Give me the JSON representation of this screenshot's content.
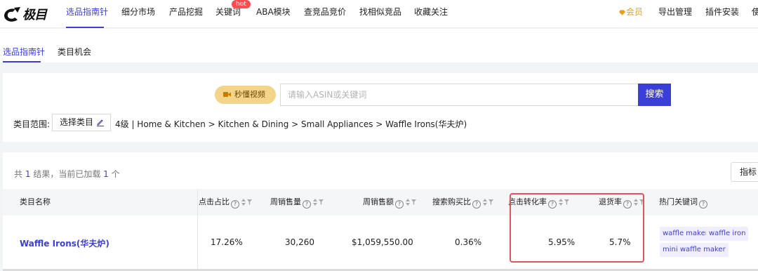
{
  "brand": {
    "logo_text": "极目"
  },
  "nav": {
    "items": [
      {
        "label": "选品指南针"
      },
      {
        "label": "细分市场"
      },
      {
        "label": "产品挖掘"
      },
      {
        "label": "关键词"
      },
      {
        "label": "ABA模块"
      },
      {
        "label": "查竞品竞价"
      },
      {
        "label": "找相似竞品"
      },
      {
        "label": "收藏关注"
      }
    ],
    "hot_badge": "hot",
    "right": {
      "vip": "会员",
      "export": "导出管理",
      "plugin": "插件安装",
      "more": "使"
    }
  },
  "subtabs": {
    "items": [
      {
        "label": "选品指南针"
      },
      {
        "label": "类目机会"
      }
    ]
  },
  "search": {
    "video_label": "秒懂视频",
    "placeholder": "请输入ASIN或关键词",
    "button_label": "搜索",
    "category_label": "类目范围:",
    "category_select": "选择类目",
    "category_path": "4级 | Home & Kitchen > Kitchen & Dining > Small Appliances > Waffle Irons(华夫炉)"
  },
  "results": {
    "prefix": "共",
    "total": "1",
    "middle": "结果，当前已加载",
    "loaded": "1",
    "suffix": "个",
    "metric_button": "指标"
  },
  "table": {
    "headers": {
      "category": "类目名称",
      "click_share": "点击占比",
      "weekly_sales": "周销售量",
      "weekly_revenue": "周销售额",
      "search_purchase": "搜索购买比",
      "click_conversion": "点击转化率",
      "return_rate": "退货率",
      "hot_keywords": "热门关键词"
    },
    "help_glyph": "?",
    "row": {
      "category": "Waffle Irons(华夫炉)",
      "click_share": "17.26%",
      "weekly_sales": "30,260",
      "weekly_revenue": "$1,059,550.00",
      "search_purchase": "0.36%",
      "click_conversion": "5.95%",
      "return_rate": "5.7%",
      "keywords": [
        "waffle maker",
        "waffle iron",
        "mini waffle maker"
      ]
    }
  },
  "colors": {
    "accent": "#3b3fd8",
    "hot": "#ff4d4f",
    "vip": "#e8a019",
    "highlight": "#e0545b"
  }
}
